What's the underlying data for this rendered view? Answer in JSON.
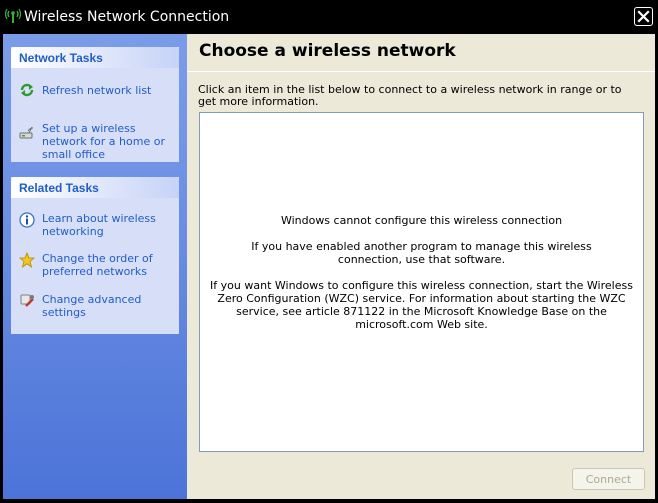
{
  "window": {
    "title": "Wireless Network Connection",
    "close_glyph": "✕"
  },
  "colors": {
    "sidebar_gradient_top": "#7b9de8",
    "sidebar_gradient_bottom": "#4c73d8",
    "task_link": "#215dc6",
    "panel_bg": "#d6dff7",
    "main_bg": "#ece9d8"
  },
  "sidebar": {
    "network_tasks": {
      "title": "Network Tasks",
      "items": [
        {
          "label": "Refresh network list",
          "icon": "refresh-icon"
        },
        {
          "label": "Set up a wireless network for a home or small office",
          "icon": "wireless-setup-icon"
        }
      ]
    },
    "related_tasks": {
      "title": "Related Tasks",
      "items": [
        {
          "label": "Learn about wireless networking",
          "icon": "info-icon"
        },
        {
          "label": "Change the order of preferred networks",
          "icon": "star-icon"
        },
        {
          "label": "Change advanced settings",
          "icon": "settings-icon"
        }
      ]
    }
  },
  "main": {
    "heading": "Choose a wireless network",
    "instruction": "Click an item in the list below to connect to a wireless network in range or to get more information.",
    "messages": [
      "Windows cannot configure this wireless connection",
      "If you have enabled another program to manage this wireless connection, use that software.",
      "If you want Windows to configure this wireless connection, start the Wireless Zero Configuration (WZC) service. For information about starting the WZC service, see article 871122 in the Microsoft Knowledge Base on the microsoft.com Web site."
    ],
    "connect_label": "Connect"
  }
}
